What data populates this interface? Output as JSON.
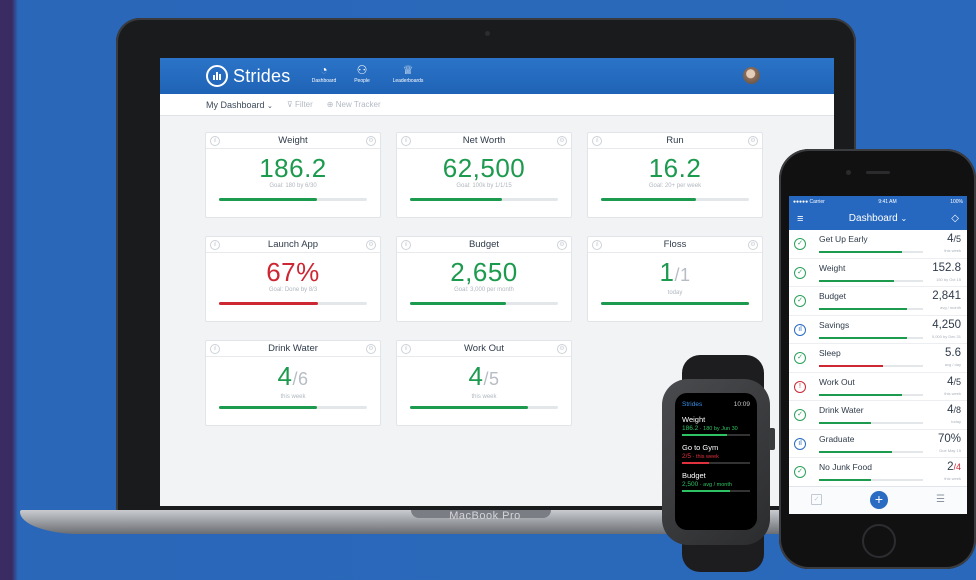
{
  "laptop": {
    "brand_label": "MacBook Pro",
    "app": {
      "name": "Strides",
      "nav": [
        {
          "icon": "dashboard-icon",
          "label": "Dashboard"
        },
        {
          "icon": "people-icon",
          "label": "People"
        },
        {
          "icon": "trophy-icon",
          "label": "Leaderboards"
        }
      ],
      "subbar": {
        "dashboard_label": "My Dashboard",
        "filter_label": "Filter",
        "new_tracker_label": "New Tracker"
      },
      "cards": [
        {
          "title": "Weight",
          "value": "186.2",
          "goal": "Goal: 180 by 6/30",
          "progress": 0.66,
          "color": "#1c9a4e"
        },
        {
          "title": "Net Worth",
          "value": "62,500",
          "goal": "Goal: 100k by 1/1/15",
          "progress": 0.62,
          "color": "#1c9a4e"
        },
        {
          "title": "Run",
          "value": "16.2",
          "goal": "Goal: 20+ per week",
          "progress": 0.64,
          "color": "#1c9a4e"
        },
        {
          "title": "Launch App",
          "value": "67%",
          "goal": "Goal: Done by 8/3",
          "progress": 0.67,
          "color": "#cc2733"
        },
        {
          "title": "Budget",
          "value": "2,650",
          "goal": "Goal: 3,000 per month",
          "progress": 0.65,
          "color": "#1c9a4e"
        },
        {
          "title": "Floss",
          "value": "1",
          "denom": "/1",
          "goal": "today",
          "progress": 1.0,
          "color": "#1c9a4e"
        },
        {
          "title": "Drink Water",
          "value": "4",
          "denom": "/6",
          "goal": "this week",
          "progress": 0.66,
          "color": "#1c9a4e"
        },
        {
          "title": "Work Out",
          "value": "4",
          "denom": "/5",
          "goal": "this week",
          "progress": 0.8,
          "color": "#1c9a4e"
        }
      ]
    }
  },
  "watch": {
    "app_name": "Strides",
    "time": "10:09",
    "items": [
      {
        "title": "Weight",
        "value": "186.2",
        "sub": "180 by Jun 30",
        "progress": 0.66,
        "color": "#2ec262"
      },
      {
        "title": "Go to Gym",
        "value": "2/5",
        "sub": "this week",
        "progress": 0.4,
        "color": "#e0323e"
      },
      {
        "title": "Budget",
        "value": "2,500",
        "sub": "avg / month",
        "progress": 0.7,
        "color": "#2ec262"
      }
    ]
  },
  "phone": {
    "status": {
      "carrier": "●●●●● Carrier",
      "time": "9:41 AM",
      "battery": "100%"
    },
    "title": "Dashboard",
    "rows": [
      {
        "icon": "check-icon",
        "name": "Get Up Early",
        "value": "4",
        "denom": "/5",
        "sub": "this week",
        "progress": 0.8,
        "color": "#1c9a4e"
      },
      {
        "icon": "check-icon",
        "name": "Weight",
        "value": "152.8",
        "sub": "150 by Oct 15",
        "progress": 0.72,
        "color": "#1c9a4e"
      },
      {
        "icon": "check-icon",
        "name": "Budget",
        "value": "2,841",
        "sub": "avg / month",
        "progress": 0.85,
        "color": "#1c9a4e"
      },
      {
        "icon": "chart-icon",
        "name": "Savings",
        "value": "4,250",
        "sub": "5,000 by Dec 31",
        "progress": 0.85,
        "color": "#1c9a4e"
      },
      {
        "icon": "check-icon",
        "name": "Sleep",
        "value": "5.6",
        "sub": "avg / day",
        "progress": 0.62,
        "color": "#cc2733"
      },
      {
        "icon": "alert-icon",
        "name": "Work Out",
        "value": "4",
        "denom": "/5",
        "sub": "this week",
        "progress": 0.8,
        "color": "#1c9a4e"
      },
      {
        "icon": "check-icon",
        "name": "Drink Water",
        "value": "4",
        "denom": "/8",
        "sub": "today",
        "progress": 0.5,
        "color": "#1c9a4e"
      },
      {
        "icon": "chart-icon",
        "name": "Graduate",
        "value": "70%",
        "sub": "Due May 15",
        "progress": 0.7,
        "color": "#1c9a4e"
      },
      {
        "icon": "check-icon",
        "name": "No Junk Food",
        "value": "2",
        "denom": "/4",
        "denom_red": true,
        "sub": "this week",
        "progress": 0.5,
        "color": "#1c9a4e"
      }
    ]
  }
}
